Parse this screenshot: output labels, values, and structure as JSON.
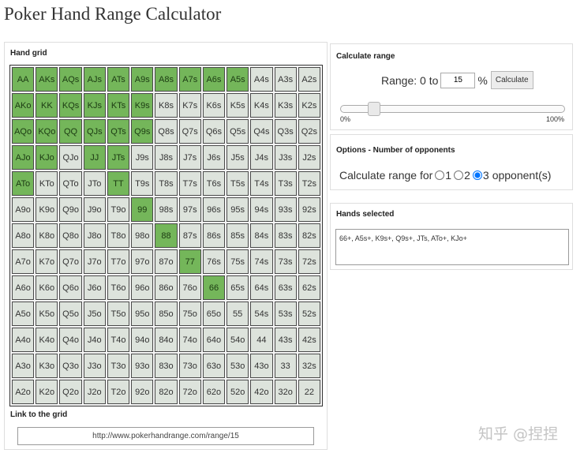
{
  "title": "Poker Hand Range Calculator",
  "hand_grid": {
    "heading": "Hand grid",
    "rows": [
      [
        "AA",
        "AKs",
        "AQs",
        "AJs",
        "ATs",
        "A9s",
        "A8s",
        "A7s",
        "A6s",
        "A5s",
        "A4s",
        "A3s",
        "A2s"
      ],
      [
        "AKo",
        "KK",
        "KQs",
        "KJs",
        "KTs",
        "K9s",
        "K8s",
        "K7s",
        "K6s",
        "K5s",
        "K4s",
        "K3s",
        "K2s"
      ],
      [
        "AQo",
        "KQo",
        "QQ",
        "QJs",
        "QTs",
        "Q9s",
        "Q8s",
        "Q7s",
        "Q6s",
        "Q5s",
        "Q4s",
        "Q3s",
        "Q2s"
      ],
      [
        "AJo",
        "KJo",
        "QJo",
        "JJ",
        "JTs",
        "J9s",
        "J8s",
        "J7s",
        "J6s",
        "J5s",
        "J4s",
        "J3s",
        "J2s"
      ],
      [
        "ATo",
        "KTo",
        "QTo",
        "JTo",
        "TT",
        "T9s",
        "T8s",
        "T7s",
        "T6s",
        "T5s",
        "T4s",
        "T3s",
        "T2s"
      ],
      [
        "A9o",
        "K9o",
        "Q9o",
        "J9o",
        "T9o",
        "99",
        "98s",
        "97s",
        "96s",
        "95s",
        "94s",
        "93s",
        "92s"
      ],
      [
        "A8o",
        "K8o",
        "Q8o",
        "J8o",
        "T8o",
        "98o",
        "88",
        "87s",
        "86s",
        "85s",
        "84s",
        "83s",
        "82s"
      ],
      [
        "A7o",
        "K7o",
        "Q7o",
        "J7o",
        "T7o",
        "97o",
        "87o",
        "77",
        "76s",
        "75s",
        "74s",
        "73s",
        "72s"
      ],
      [
        "A6o",
        "K6o",
        "Q6o",
        "J6o",
        "T6o",
        "96o",
        "86o",
        "76o",
        "66",
        "65s",
        "64s",
        "63s",
        "62s"
      ],
      [
        "A5o",
        "K5o",
        "Q5o",
        "J5o",
        "T5o",
        "95o",
        "85o",
        "75o",
        "65o",
        "55",
        "54s",
        "53s",
        "52s"
      ],
      [
        "A4o",
        "K4o",
        "Q4o",
        "J4o",
        "T4o",
        "94o",
        "84o",
        "74o",
        "64o",
        "54o",
        "44",
        "43s",
        "42s"
      ],
      [
        "A3o",
        "K3o",
        "Q3o",
        "J3o",
        "T3o",
        "93o",
        "83o",
        "73o",
        "63o",
        "53o",
        "43o",
        "33",
        "32s"
      ],
      [
        "A2o",
        "K2o",
        "Q2o",
        "J2o",
        "T2o",
        "92o",
        "82o",
        "72o",
        "62o",
        "52o",
        "42o",
        "32o",
        "22"
      ]
    ],
    "selected": [
      "AA",
      "AKs",
      "AQs",
      "AJs",
      "ATs",
      "A9s",
      "A8s",
      "A7s",
      "A6s",
      "A5s",
      "AKo",
      "KK",
      "KQs",
      "KJs",
      "KTs",
      "K9s",
      "AQo",
      "KQo",
      "QQ",
      "QJs",
      "QTs",
      "Q9s",
      "AJo",
      "KJo",
      "JJ",
      "JTs",
      "ATo",
      "TT",
      "99",
      "88",
      "77",
      "66"
    ],
    "selected_color": "#74b65a",
    "unselected_color": "#dde3dc"
  },
  "link": {
    "heading": "Link to the grid",
    "url": "http://www.pokerhandrange.com/range/15"
  },
  "calculate": {
    "heading": "Calculate range",
    "label_prefix": "Range: 0 to",
    "value": "15",
    "unit": "%",
    "button_label": "Calculate",
    "slider_value_percent": 15,
    "slider_min_label": "0%",
    "slider_max_label": "100%"
  },
  "options": {
    "heading": "Options - Number of opponents",
    "label": "Calculate range for",
    "choices": [
      "1",
      "2",
      "3"
    ],
    "selected": "3",
    "suffix": "opponent(s)"
  },
  "hands_selected": {
    "heading": "Hands selected",
    "text": "66+, A5s+, K9s+, Q9s+, JTs, ATo+, KJo+"
  },
  "watermark": "知乎 @捏捏"
}
